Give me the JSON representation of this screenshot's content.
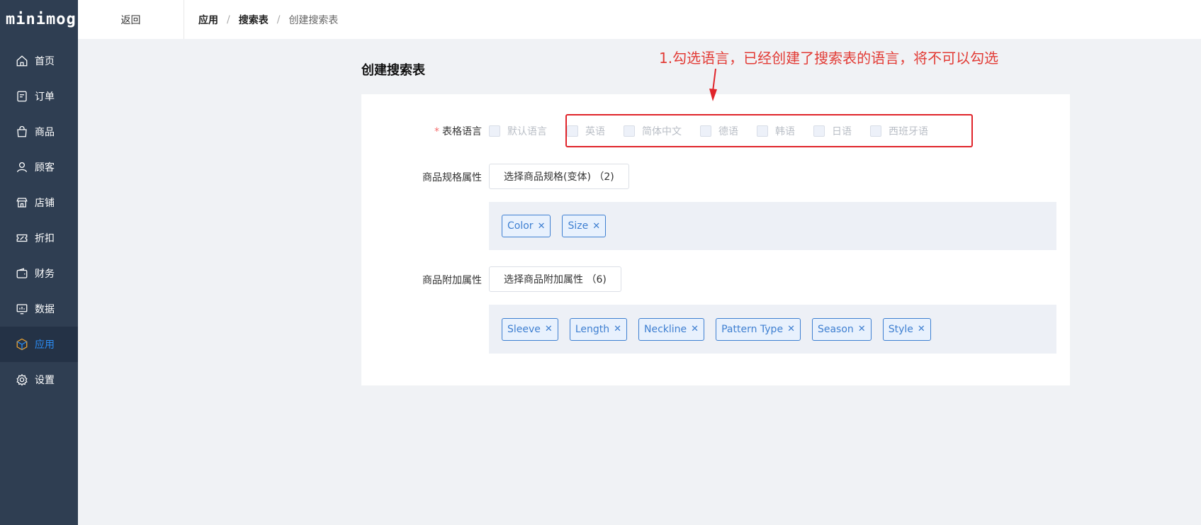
{
  "app": {
    "logo": "minimog"
  },
  "sidebar": {
    "items": [
      {
        "label": "首页",
        "icon": "home-icon"
      },
      {
        "label": "订单",
        "icon": "order-icon"
      },
      {
        "label": "商品",
        "icon": "bag-icon"
      },
      {
        "label": "顾客",
        "icon": "user-icon"
      },
      {
        "label": "店铺",
        "icon": "store-icon"
      },
      {
        "label": "折扣",
        "icon": "discount-icon"
      },
      {
        "label": "财务",
        "icon": "wallet-icon"
      },
      {
        "label": "数据",
        "icon": "chart-icon"
      },
      {
        "label": "应用",
        "icon": "app-cube-icon",
        "active": true
      },
      {
        "label": "设置",
        "icon": "gear-icon"
      }
    ]
  },
  "topbar": {
    "back_label": "返回",
    "breadcrumb": [
      "应用",
      "搜索表",
      "创建搜索表"
    ],
    "separator": "/"
  },
  "main": {
    "title": "创建搜索表",
    "language": {
      "required_mark": "*",
      "label": "表格语言",
      "options": [
        "默认语言",
        "英语",
        "简体中文",
        "德语",
        "韩语",
        "日语",
        "西班牙语"
      ]
    },
    "spec": {
      "label": "商品规格属性",
      "button_label": "选择商品规格(变体) （2)",
      "tags": [
        "Color",
        "Size"
      ]
    },
    "extra": {
      "label": "商品附加属性",
      "button_label": "选择商品附加属性 （6)",
      "tags": [
        "Sleeve",
        "Length",
        "Neckline",
        "Pattern Type",
        "Season",
        "Style"
      ]
    }
  },
  "annotation": {
    "text": "1.勾选语言，已经创建了搜索表的语言，将不可以勾选",
    "color": "#e23b35"
  },
  "colors": {
    "sidebar_bg": "#2f3e52",
    "active_accent": "#2b8cf4",
    "tag_accent": "#3e7fd1"
  }
}
